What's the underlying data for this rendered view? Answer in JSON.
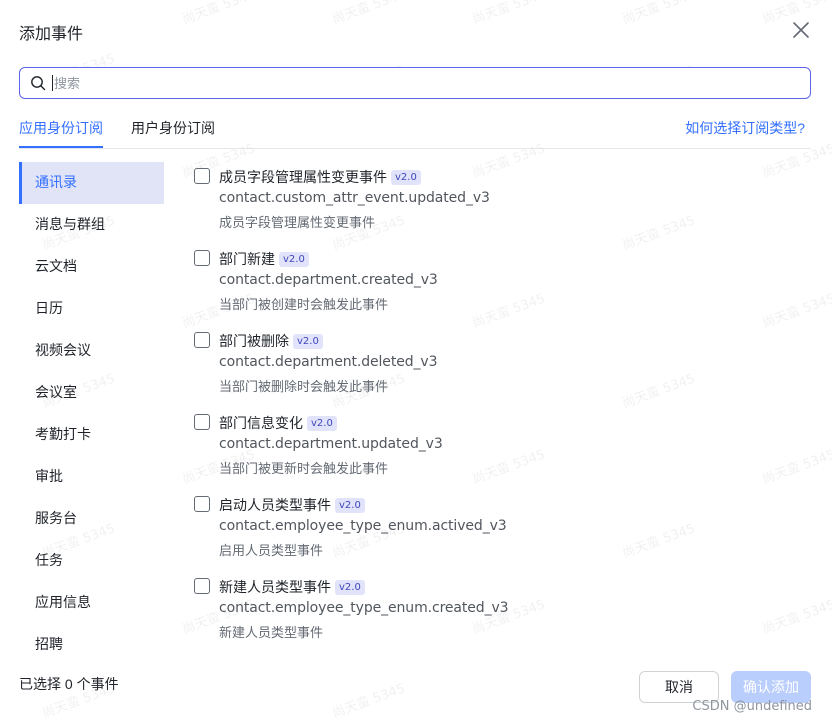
{
  "dialog": {
    "title": "添加事件",
    "close_icon": "close-icon"
  },
  "search": {
    "placeholder": "搜索",
    "value": ""
  },
  "tabs": [
    {
      "label": "应用身份订阅",
      "active": true
    },
    {
      "label": "用户身份订阅",
      "active": false
    }
  ],
  "help_link": "如何选择订阅类型?",
  "sidebar": {
    "items": [
      {
        "label": "通讯录",
        "active": true
      },
      {
        "label": "消息与群组",
        "active": false
      },
      {
        "label": "云文档",
        "active": false
      },
      {
        "label": "日历",
        "active": false
      },
      {
        "label": "视频会议",
        "active": false
      },
      {
        "label": "会议室",
        "active": false
      },
      {
        "label": "考勤打卡",
        "active": false
      },
      {
        "label": "审批",
        "active": false
      },
      {
        "label": "服务台",
        "active": false
      },
      {
        "label": "任务",
        "active": false
      },
      {
        "label": "应用信息",
        "active": false
      },
      {
        "label": "招聘",
        "active": false
      }
    ]
  },
  "events": [
    {
      "name": "成员字段管理属性变更事件",
      "version": "v2.0",
      "key": "contact.custom_attr_event.updated_v3",
      "desc": "成员字段管理属性变更事件",
      "checked": false
    },
    {
      "name": "部门新建",
      "version": "v2.0",
      "key": "contact.department.created_v3",
      "desc": "当部门被创建时会触发此事件",
      "checked": false
    },
    {
      "name": "部门被删除",
      "version": "v2.0",
      "key": "contact.department.deleted_v3",
      "desc": "当部门被删除时会触发此事件",
      "checked": false
    },
    {
      "name": "部门信息变化",
      "version": "v2.0",
      "key": "contact.department.updated_v3",
      "desc": "当部门被更新时会触发此事件",
      "checked": false
    },
    {
      "name": "启动人员类型事件",
      "version": "v2.0",
      "key": "contact.employee_type_enum.actived_v3",
      "desc": "启用人员类型事件",
      "checked": false
    },
    {
      "name": "新建人员类型事件",
      "version": "v2.0",
      "key": "contact.employee_type_enum.created_v3",
      "desc": "新建人员类型事件",
      "checked": false
    }
  ],
  "footer": {
    "selected_count": "已选择 0 个事件",
    "cancel_label": "取消",
    "confirm_label": "确认添加",
    "watermark_credit": "CSDN @undefined"
  },
  "watermark": "尚天蛮 5345",
  "colors": {
    "accent": "#3370ff",
    "search_border": "#5b65e8",
    "active_sidebar_bg": "#e1e3f7",
    "badge_bg": "#e1e3fa",
    "confirm_disabled_bg": "#bacefd"
  }
}
